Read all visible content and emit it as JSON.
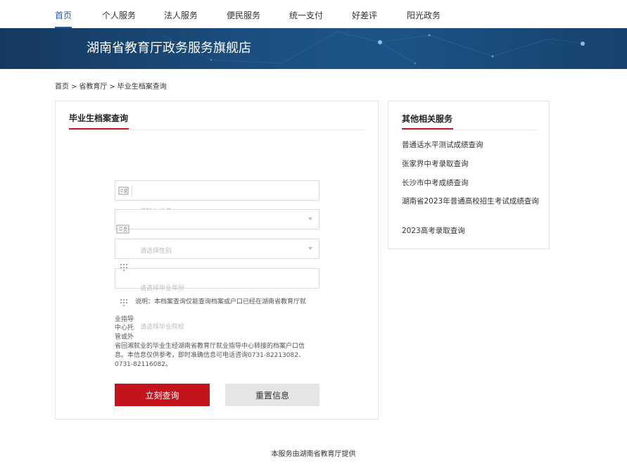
{
  "nav": {
    "items": [
      {
        "label": "首页"
      },
      {
        "label": "个人服务"
      },
      {
        "label": "法人服务"
      },
      {
        "label": "便民服务"
      },
      {
        "label": "统一支付"
      },
      {
        "label": "好差评"
      },
      {
        "label": "阳光政务"
      }
    ],
    "active_color": "#1b5fa8"
  },
  "banner": {
    "title": "湖南省教育厅政务服务旗舰店"
  },
  "breadcrumb": {
    "items": [
      "首页",
      "省教育厅",
      "毕业生档案查询"
    ],
    "separator": ">"
  },
  "form": {
    "title": "毕业生档案查询",
    "name_placeholder": "请输入姓名",
    "gender_placeholder": "请选择性别",
    "year_placeholder": "请选择毕业年份",
    "school_placeholder": "请选择毕业院校",
    "note_line1": "说明：本档案查询仅能查询档案或户口已经在湖南省教育厅就",
    "note_line2": "业指导",
    "note_line3": "中心托",
    "note_line4": "管或外",
    "note_line5": "省回湘就业的毕业生经湖南省教育厅就业指导中心转接的档案户口信",
    "note_line6": "息。本信息仅供参考，即时准确信息可电话咨询0731-82213082、",
    "note_line7": "0731-82116082。",
    "query_button": "立刻查询",
    "reset_button": "重置信息",
    "accent_color": "#c4141b"
  },
  "side": {
    "title": "其他相关服务",
    "links": [
      {
        "label": "普通话水平测试成绩查询"
      },
      {
        "label": "张家界中考录取查询"
      },
      {
        "label": "长沙市中考成绩查询"
      },
      {
        "label": "湖南省2023年普通高校招生考试成绩查询"
      },
      {
        "label": "2023高考录取查询"
      }
    ]
  },
  "footer": {
    "text": "本服务由湖南省教育厅提供"
  }
}
